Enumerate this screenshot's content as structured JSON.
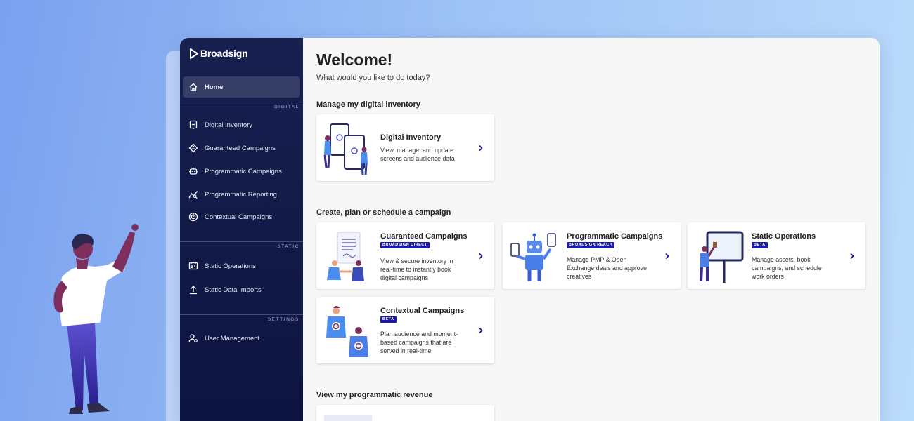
{
  "sidebar": {
    "logo": "Broadsign",
    "items": [
      {
        "label": "Home",
        "icon": "home-icon"
      },
      {
        "label": "Digital Inventory",
        "icon": "screen-icon"
      },
      {
        "label": "Guaranteed Campaigns",
        "icon": "tag-icon"
      },
      {
        "label": "Programmatic Campaigns",
        "icon": "robot-icon"
      },
      {
        "label": "Programmatic Reporting",
        "icon": "chart-icon"
      },
      {
        "label": "Contextual Campaigns",
        "icon": "target-icon"
      },
      {
        "label": "Static Operations",
        "icon": "calendar-icon"
      },
      {
        "label": "Static Data Imports",
        "icon": "upload-icon"
      },
      {
        "label": "User Management",
        "icon": "user-gear-icon"
      }
    ],
    "sections": {
      "digital": "DIGITAL",
      "static": "STATIC",
      "settings": "SETTINGS"
    }
  },
  "main": {
    "title": "Welcome!",
    "subtitle": "What would you like to do today?",
    "sections": {
      "inventory": "Manage my digital inventory",
      "campaign": "Create, plan or schedule a campaign",
      "revenue": "View my programmatic revenue"
    },
    "cards": {
      "digital_inventory": {
        "title": "Digital Inventory",
        "desc1": "View, manage, and update",
        "desc2": "screens and audience data"
      },
      "guaranteed": {
        "title": "Guaranteed Campaigns",
        "tag": "BROADSIGN DIRECT",
        "desc1": "View & secure inventory in",
        "desc2": "real-time to instantly book",
        "desc3": "digital campaigns"
      },
      "programmatic": {
        "title": "Programmatic Campaigns",
        "tag": "BROADSIGN REACH",
        "desc1": "Manage PMP & Open",
        "desc2": "Exchange deals and approve",
        "desc3": "creatives"
      },
      "static_ops": {
        "title": "Static Operations",
        "tag": "BETA",
        "desc1": "Manage assets, book",
        "desc2": "campaigns, and schedule",
        "desc3": "work orders"
      },
      "contextual": {
        "title": "Contextual Campaigns",
        "tag": "BETA",
        "desc1": "Plan audience and moment-",
        "desc2": "based campaigns that are",
        "desc3": "served in real-time"
      }
    }
  },
  "colors": {
    "sidebar": "#17204f",
    "accent": "#1d1aa6",
    "tag": "#1d1aa6"
  }
}
